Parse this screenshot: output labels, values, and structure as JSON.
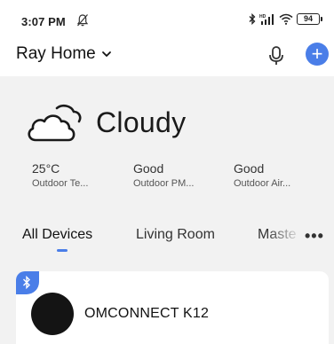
{
  "status_bar": {
    "time": "3:07 PM",
    "battery": "94",
    "network_label": "HD"
  },
  "header": {
    "home_name": "Ray Home",
    "add_label": "+"
  },
  "weather": {
    "condition": "Cloudy",
    "metrics": [
      {
        "value": "25°C",
        "label": "Outdoor Te..."
      },
      {
        "value": "Good",
        "label": "Outdoor PM..."
      },
      {
        "value": "Good",
        "label": "Outdoor Air..."
      }
    ]
  },
  "tabs": {
    "items": [
      {
        "label": "All Devices"
      },
      {
        "label": "Living Room"
      },
      {
        "label": "Maste"
      }
    ],
    "more_label": "•••"
  },
  "devices": [
    {
      "name": "OMCONNECT K12"
    }
  ],
  "colors": {
    "accent": "#4a7ee8",
    "background": "#f2f2f2",
    "card": "#ffffff"
  },
  "icons": {
    "mute": "bell-off-icon",
    "bluetooth": "bluetooth-icon",
    "signal": "signal-icon",
    "wifi": "wifi-icon",
    "battery": "battery-icon",
    "chevron": "chevron-down-icon",
    "mic": "microphone-icon",
    "add": "plus-icon",
    "weather": "cloud-icon"
  }
}
